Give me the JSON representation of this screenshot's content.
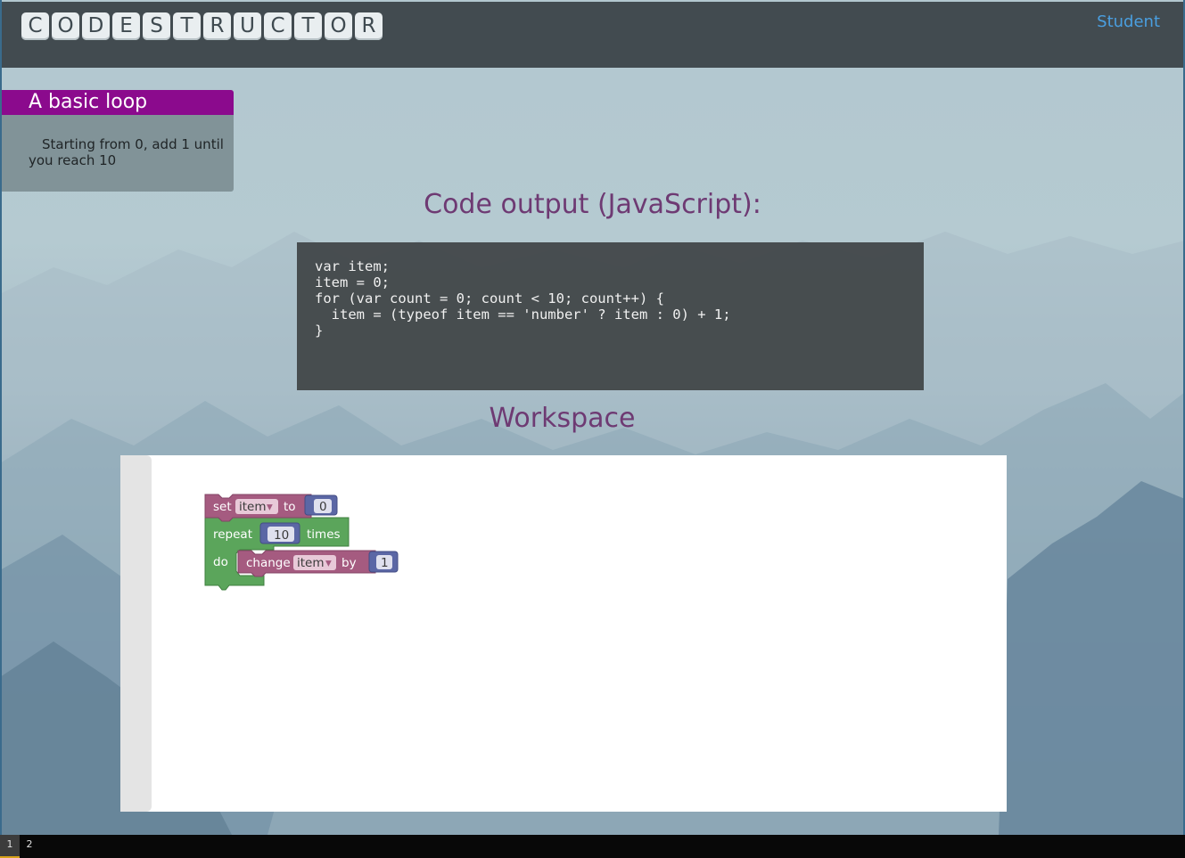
{
  "header": {
    "logo_letters": [
      "C",
      "O",
      "D",
      "E",
      "S",
      "T",
      "R",
      "U",
      "C",
      "T",
      "O",
      "R"
    ],
    "user_label": "Student"
  },
  "exercise": {
    "title": "A basic loop",
    "description": "Starting from 0, add 1 until you reach 10"
  },
  "code_output": {
    "heading": "Code output (JavaScript):",
    "lines": [
      "var item;",
      "",
      "",
      "item = 0;",
      "for (var count = 0; count < 10; count++) {",
      "  item = (typeof item == 'number' ? item : 0) + 1;",
      "}"
    ]
  },
  "workspace": {
    "heading": "Workspace",
    "blocks": {
      "set_label": "set",
      "set_var": "item",
      "set_to_label": "to",
      "set_value": "0",
      "repeat_label": "repeat",
      "repeat_count": "10",
      "repeat_times_label": "times",
      "do_label": "do",
      "change_label": "change",
      "change_var": "item",
      "change_by_label": "by",
      "change_value": "1",
      "dropdown_arrow": "▾"
    },
    "colors": {
      "variable_block": "#a55b80",
      "loop_block": "#5ba55b",
      "number_block": "#5b67a5"
    }
  },
  "taskbar": {
    "workspaces": [
      "1",
      "2"
    ],
    "active": "1"
  }
}
